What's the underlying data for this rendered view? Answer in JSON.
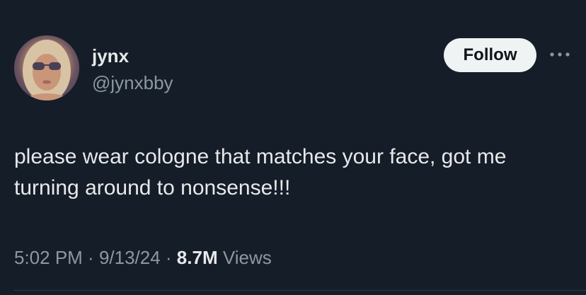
{
  "author": {
    "name": "jynx",
    "handle": "@jynxbby"
  },
  "actions": {
    "follow_label": "Follow",
    "more_icon": "more-horizontal-icon"
  },
  "tweet": {
    "text": "please wear cologne that matches your face, got me turning around to nonsense!!!"
  },
  "meta": {
    "time": "5:02 PM",
    "separator": " · ",
    "date": "9/13/24",
    "views_count": "8.7M",
    "views_label": " Views"
  },
  "colors": {
    "background": "#151d28",
    "primary_text": "#e7e9ea",
    "secondary_text": "#8b98a5",
    "follow_button_bg": "#eff3f4"
  }
}
